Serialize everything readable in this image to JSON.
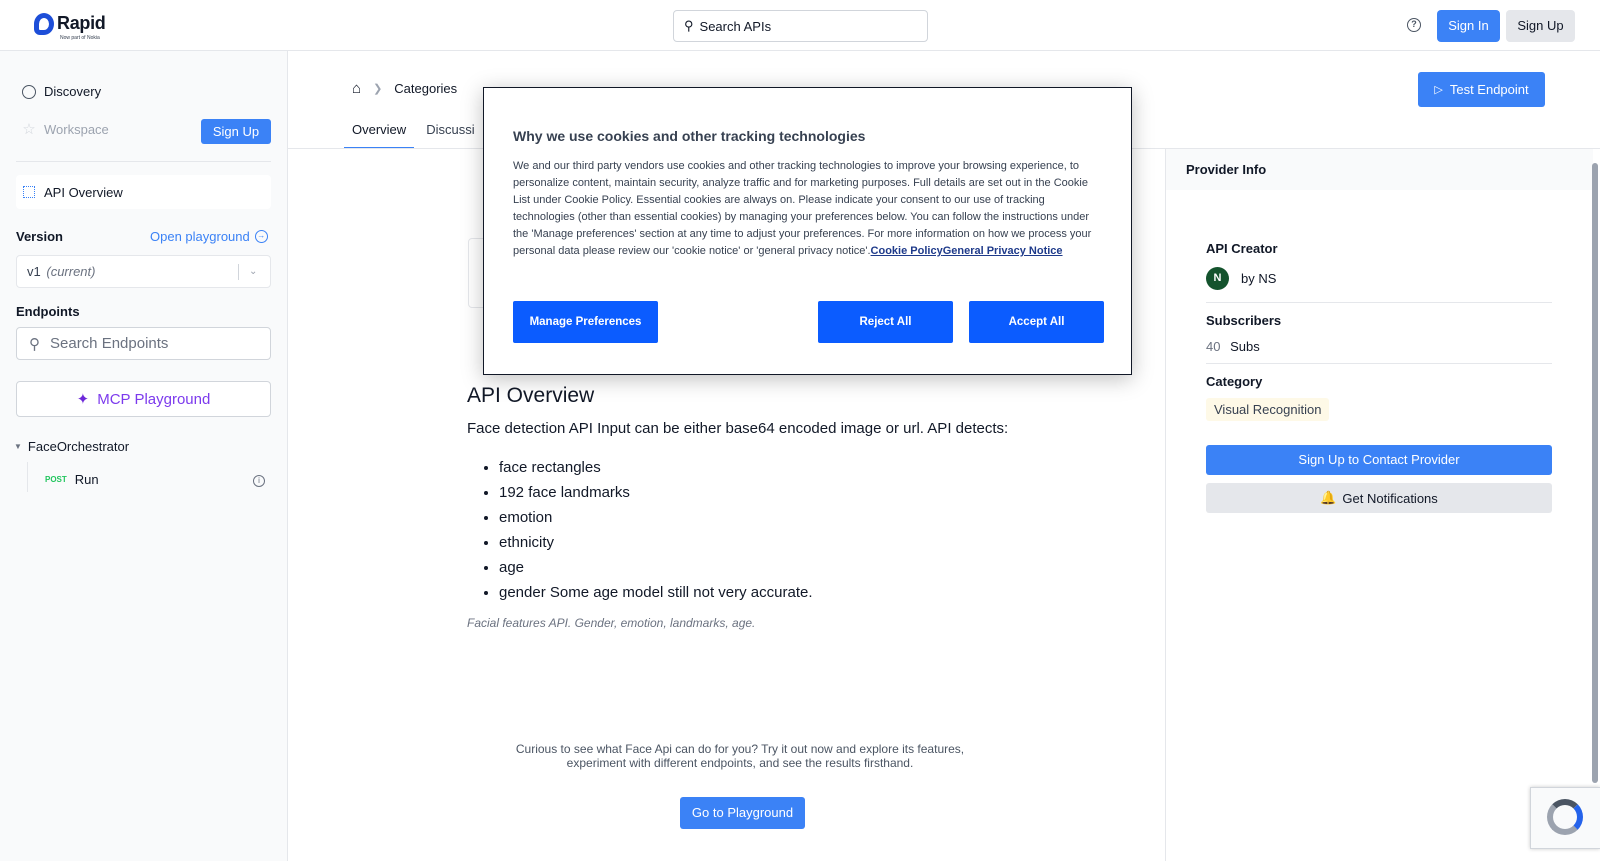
{
  "header": {
    "logo_text": "Rapid",
    "logo_sub": "Now part of Nokia",
    "search_placeholder": "Search APIs",
    "signin_label": "Sign In",
    "signup_label": "Sign Up"
  },
  "sidebar": {
    "discovery_label": "Discovery",
    "workspace_label": "Workspace",
    "signup_label": "Sign Up",
    "api_overview_label": "API Overview",
    "version_label": "Version",
    "open_playground_label": "Open playground",
    "version_value": "v1",
    "version_current": "(current)",
    "endpoints_label": "Endpoints",
    "search_endpoints_placeholder": "Search Endpoints",
    "mcp_label": "MCP Playground",
    "group_label": "FaceOrchestrator",
    "endpoint_method": "POST",
    "endpoint_name": "Run"
  },
  "content": {
    "breadcrumb_categories": "Categories",
    "test_endpoint_label": "Test Endpoint",
    "tabs": [
      "Overview",
      "Discussi"
    ],
    "api_title": "API Overview",
    "api_description": "Face detection API Input can be either base64 encoded image or url. API detects:",
    "bullets": [
      "face rectangles",
      "192 face landmarks",
      "emotion",
      "ethnicity",
      "age",
      "gender Some age model still not very accurate."
    ],
    "tagline": "Facial features API. Gender, emotion, landmarks, age.",
    "curious_text": "Curious to see what Face Api can do for you? Try it out now and explore its features, experiment with different endpoints, and see the results firsthand.",
    "goto_playground_label": "Go to Playground"
  },
  "provider": {
    "head": "Provider Info",
    "creator_label": "API Creator",
    "avatar_letter": "N",
    "creator_name": "by NS",
    "subscribers_label": "Subscribers",
    "subscribers_count": "40",
    "subscribers_unit": "Subs",
    "category_label": "Category",
    "category_value": "Visual Recognition",
    "contact_label": "Sign Up to Contact Provider",
    "notifications_label": "Get Notifications"
  },
  "cookie": {
    "title": "Why we use cookies and other tracking technologies",
    "body": "We and our third party vendors use cookies and other tracking technologies to improve your browsing experience, to personalize content, maintain security, analyze traffic and for marketing purposes. Full details are set out in the Cookie List under Cookie Policy. Essential cookies are always on. Please indicate your consent to our use of tracking technologies (other than essential cookies) by managing your preferences below. You can follow the instructions under the 'Manage preferences' section at any time to adjust your preferences. For more information on how we process your personal data please review our 'cookie notice' or 'general privacy notice'.",
    "link_cookie_policy": "Cookie Policy",
    "link_privacy": "General Privacy Notice",
    "manage_label": "Manage Preferences",
    "reject_label": "Reject All",
    "accept_label": "Accept All"
  },
  "colors": {
    "accent": "#3b82f6",
    "cookie_button": "#0b5cff",
    "mcp": "#7c3aed",
    "post_method": "#22c55e"
  }
}
